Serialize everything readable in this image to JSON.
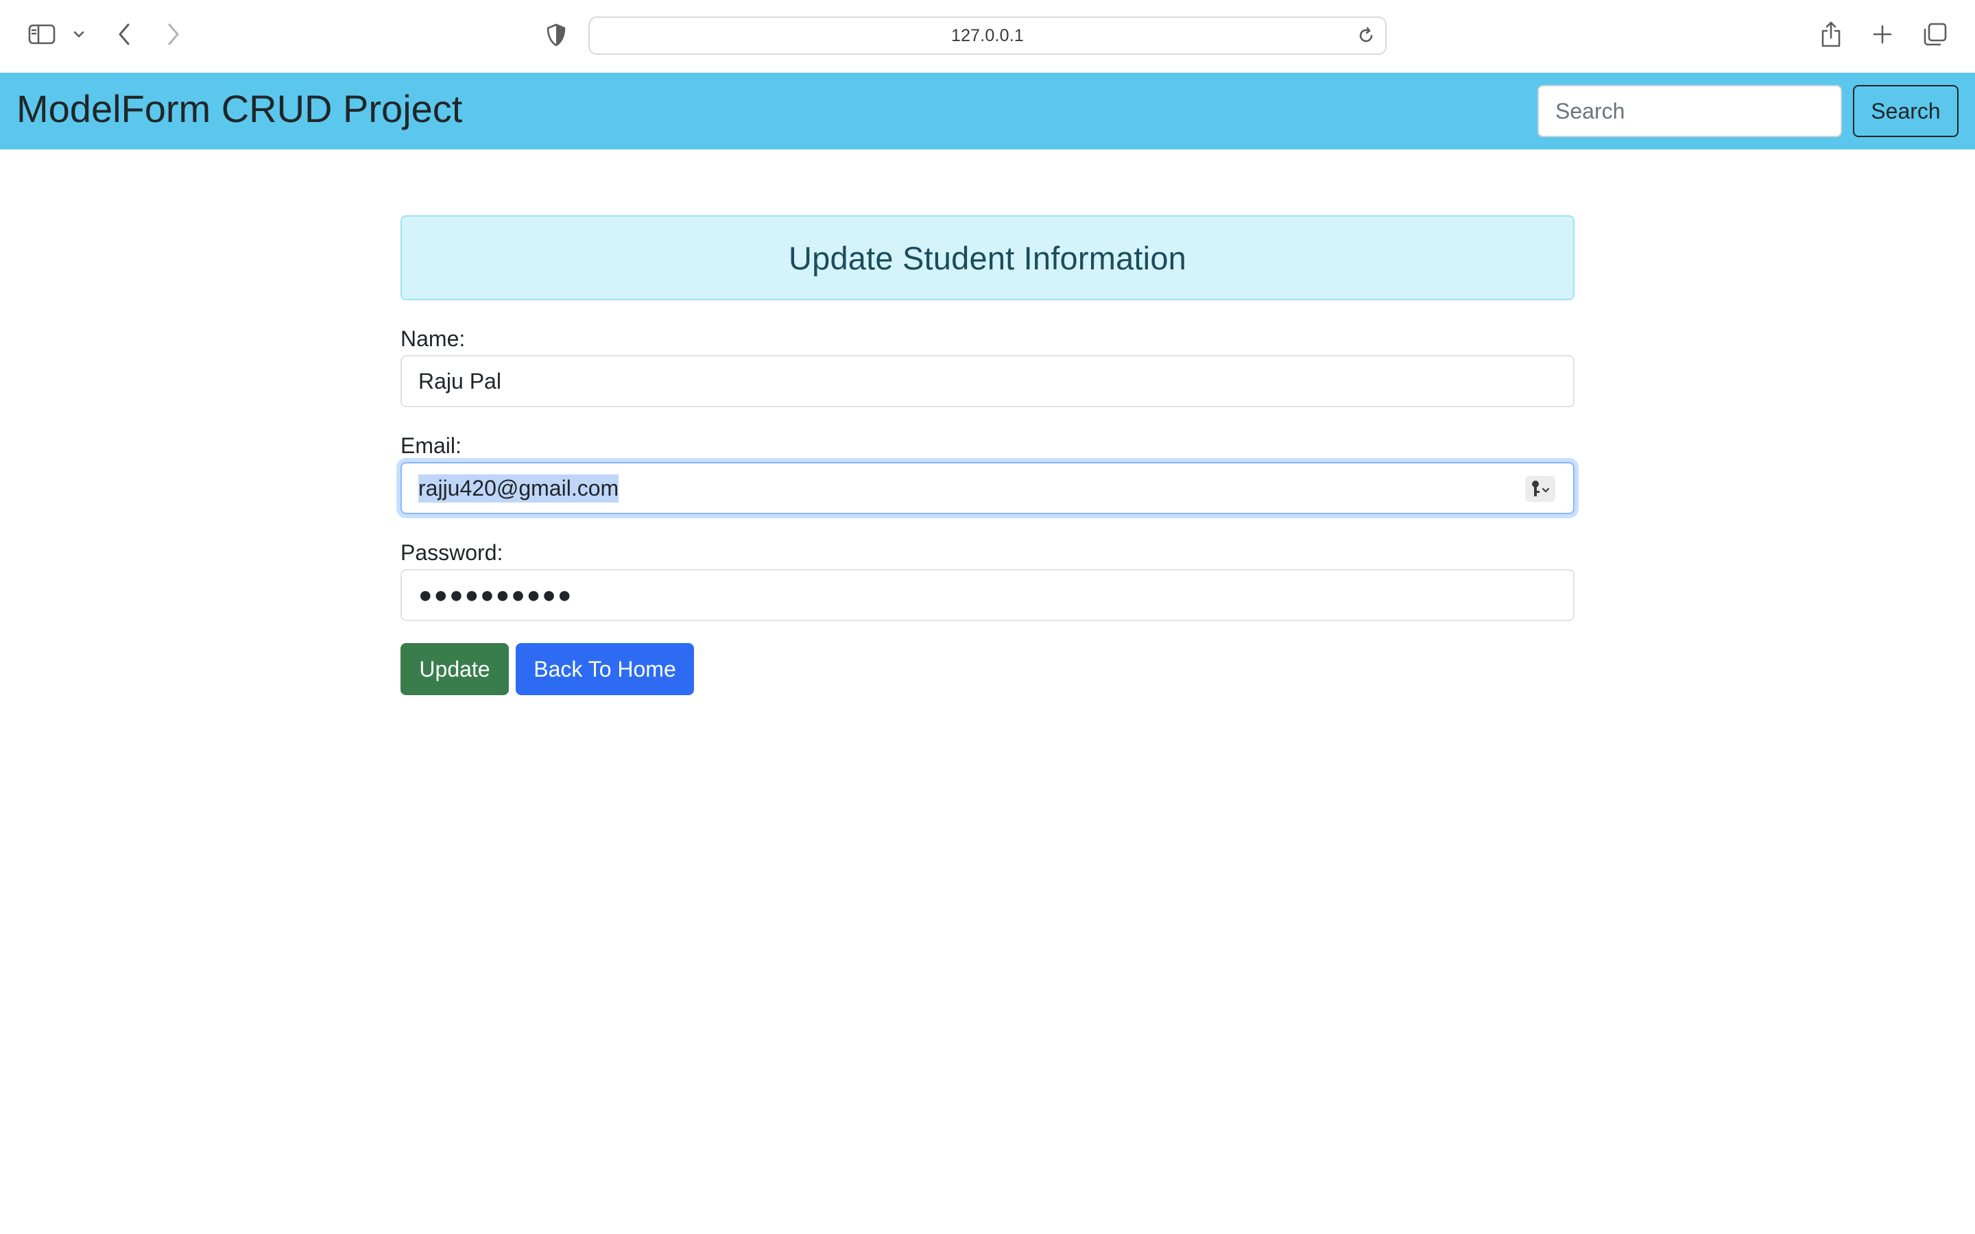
{
  "browser": {
    "url": "127.0.0.1"
  },
  "navbar": {
    "brand": "ModelForm CRUD Project",
    "search_placeholder": "Search",
    "search_button": "Search",
    "color": "#5bc7ec"
  },
  "form": {
    "title": "Update Student Information",
    "name_label": "Name:",
    "name_value": "Raju Pal",
    "email_label": "Email:",
    "email_value": "rajju420@gmail.com",
    "password_label": "Password:",
    "password_masked": "●●●●●●●●●●",
    "update_button": "Update",
    "home_button": "Back To Home"
  },
  "colors": {
    "update": "#3a7d4d",
    "home": "#2d6cf2",
    "heading_bg": "#d4f3fb"
  },
  "icons": [
    "sidebar-icon",
    "chevron-down-icon",
    "back-icon",
    "forward-icon",
    "shield-icon",
    "reload-icon",
    "share-icon",
    "plus-icon",
    "tabs-icon",
    "key-icon"
  ]
}
